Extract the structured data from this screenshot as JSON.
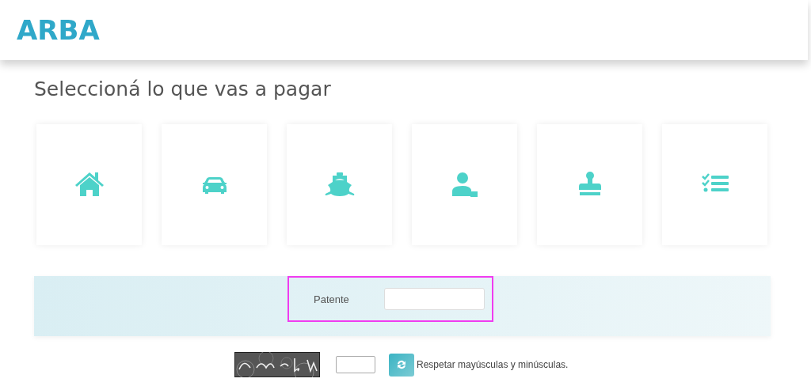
{
  "header": {
    "logo": "ARBA"
  },
  "title": "Seleccioná lo que vas a pagar",
  "categories": [
    {
      "kind": "house"
    },
    {
      "kind": "car"
    },
    {
      "kind": "boat"
    },
    {
      "kind": "person"
    },
    {
      "kind": "stamp"
    },
    {
      "kind": "checklist"
    }
  ],
  "form": {
    "label": "Patente",
    "highlighted": true
  },
  "captcha": {
    "hint": "Respetar mayúsculas y minúsculas."
  }
}
